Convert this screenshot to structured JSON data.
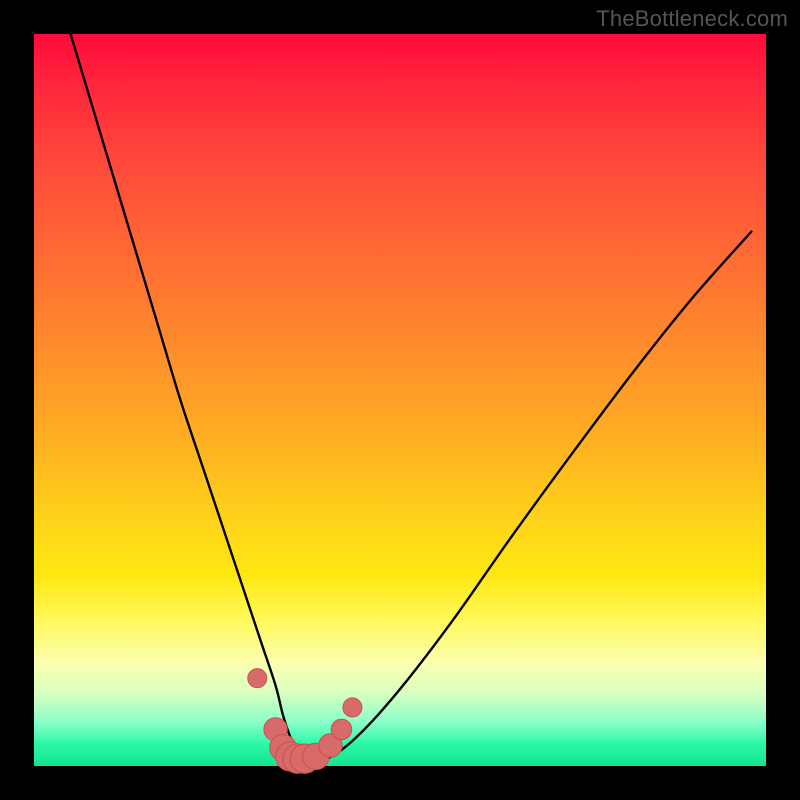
{
  "watermark": "TheBottleneck.com",
  "colors": {
    "frame": "#000000",
    "curve": "#000000",
    "dot_fill": "#d86a6a",
    "dot_stroke": "#c95050",
    "gradient_top": "#ff0a3a",
    "gradient_bottom": "#12e58e"
  },
  "chart_data": {
    "type": "line",
    "title": "",
    "xlabel": "",
    "ylabel": "",
    "xlim": [
      0,
      100
    ],
    "ylim": [
      0,
      100
    ],
    "grid": false,
    "legend": false,
    "series": [
      {
        "name": "curve",
        "x": [
          5,
          8,
          11,
          14,
          17,
          20,
          23,
          25,
          27,
          29,
          31,
          33,
          34,
          35,
          36,
          38,
          40,
          43,
          47,
          52,
          58,
          65,
          73,
          82,
          90,
          98
        ],
        "values": [
          100,
          90,
          80,
          70,
          60,
          50,
          41,
          35,
          29,
          23,
          17,
          11,
          7,
          4,
          2,
          1,
          1,
          3,
          7,
          13,
          21,
          31,
          42,
          54,
          64,
          73
        ]
      }
    ],
    "annotations": {
      "dots": {
        "description": "salmon circular markers along the bottom of the curve",
        "x": [
          30.5,
          33.0,
          34.0,
          35.0,
          36.0,
          37.0,
          38.5,
          40.5,
          42.0,
          43.5
        ],
        "values": [
          12.0,
          5.0,
          2.5,
          1.3,
          1.0,
          1.0,
          1.3,
          2.8,
          5.0,
          8.0
        ],
        "radius": [
          1.3,
          1.6,
          1.8,
          2.0,
          2.0,
          2.0,
          1.8,
          1.6,
          1.4,
          1.3
        ]
      }
    }
  }
}
